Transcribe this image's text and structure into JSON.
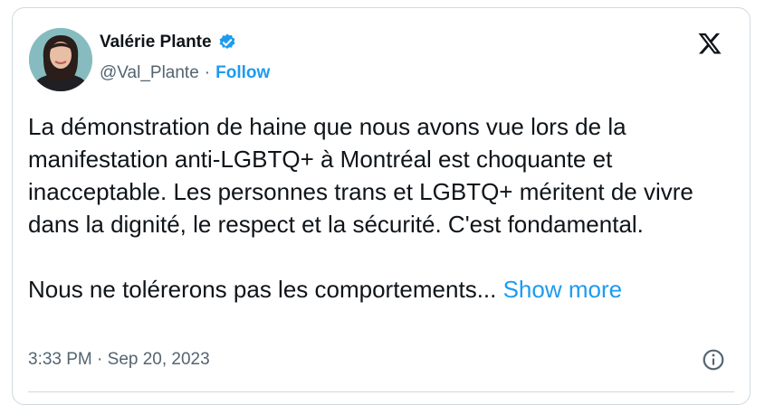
{
  "author": {
    "name": "Valérie Plante",
    "handle": "@Val_Plante",
    "separator": "·",
    "follow_label": "Follow"
  },
  "tweet": {
    "paragraph_1": "La démonstration de haine que nous avons vue lors de la manifestation anti-LGBTQ+ à Montréal est choquante et inacceptable. Les personnes trans et LGBTQ+ méritent de vivre dans la dignité, le respect et la sécurité. C'est fondamental.",
    "paragraph_2": "Nous ne tolérerons pas les comportements...",
    "show_more_label": "Show more"
  },
  "meta": {
    "timestamp": "3:33 PM · Sep 20, 2023"
  },
  "icons": {
    "verified": "verified-badge-icon",
    "logo": "x-logo-icon",
    "info": "info-icon"
  },
  "colors": {
    "accent": "#1d9bf0",
    "text": "#0f1419",
    "secondary": "#536471",
    "border": "#cfd9de"
  }
}
